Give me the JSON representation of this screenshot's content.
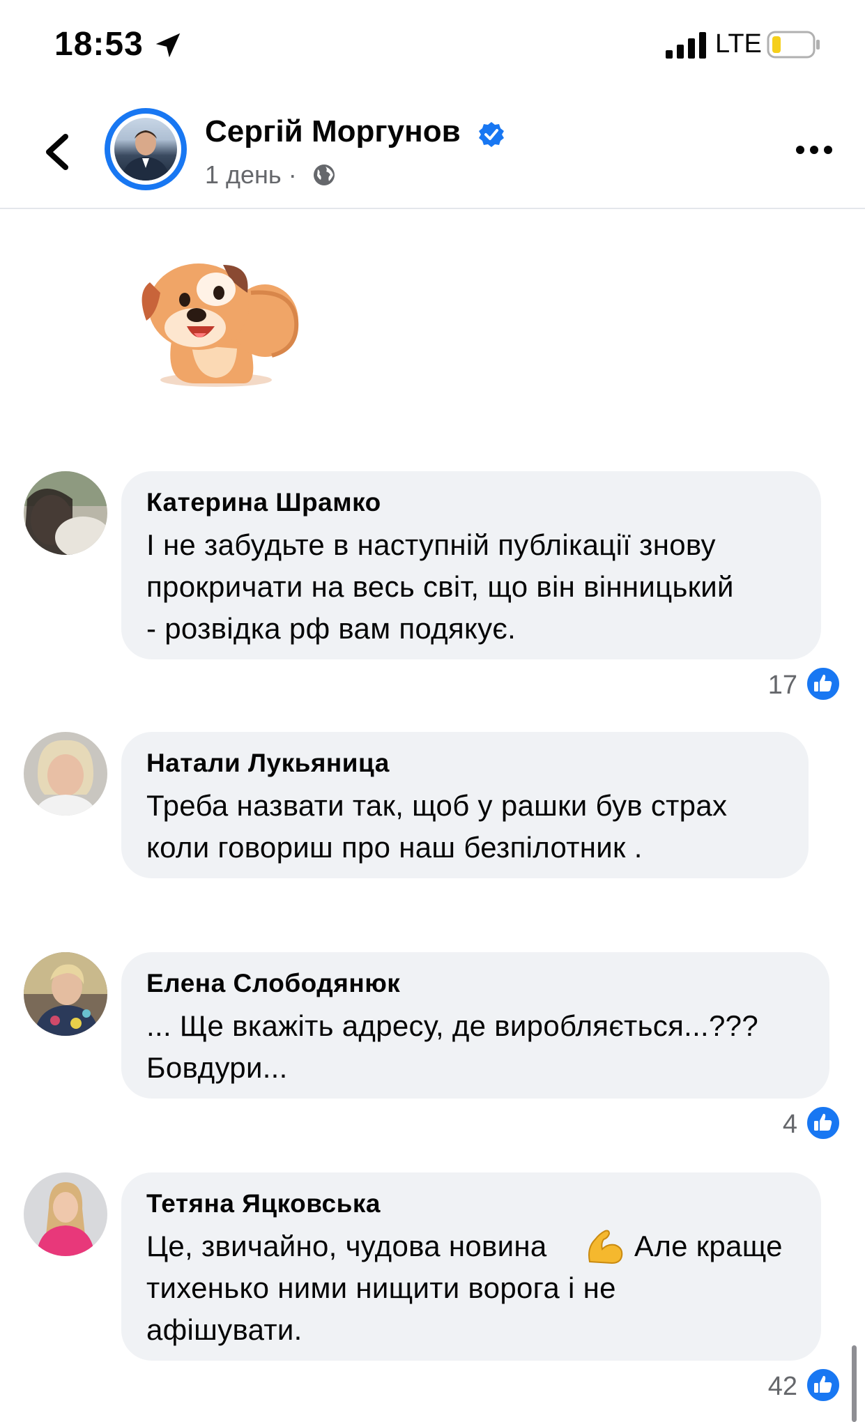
{
  "status_bar": {
    "time": "18:53",
    "network": "LTE",
    "icons": [
      "location-arrow-icon",
      "signal-icon",
      "battery-icon"
    ],
    "battery_color": "#f5cf1b"
  },
  "header": {
    "author_name": "Сергій Моргунов",
    "post_time": "1 день ·",
    "verified": true,
    "accent_color": "#1877f2",
    "icons": [
      "back-arrow-icon",
      "verified-badge-icon",
      "globe-icon",
      "more-icon"
    ]
  },
  "sticker": {
    "name": "puppy-sticker"
  },
  "comments": [
    {
      "name": "Катерина Шрамко",
      "lines": [
        "І не забудьте в наступній публікації знову",
        "прокричати на весь світ, що він вінницький",
        "- розвідка рф вам подякує."
      ],
      "reactions": "17"
    },
    {
      "name": "Натали Лукьяница",
      "lines": [
        "Треба назвати так, щоб у рашки був страх",
        "коли говориш про наш безпілотник ."
      ],
      "reactions": ""
    },
    {
      "name": "Елена Слободянюк",
      "lines": [
        "... Ще вкажіть адресу, де виробляється...???",
        "Бовдури..."
      ],
      "reactions": "4"
    },
    {
      "name": "Тетяна Яцковська",
      "lines": [
        "Це, звичайно, чудова новина",
        "Але краще",
        "тихенько ними нищити ворога і не",
        "афішувати."
      ],
      "emoji": "flexed-biceps-icon",
      "reactions": "42"
    }
  ]
}
